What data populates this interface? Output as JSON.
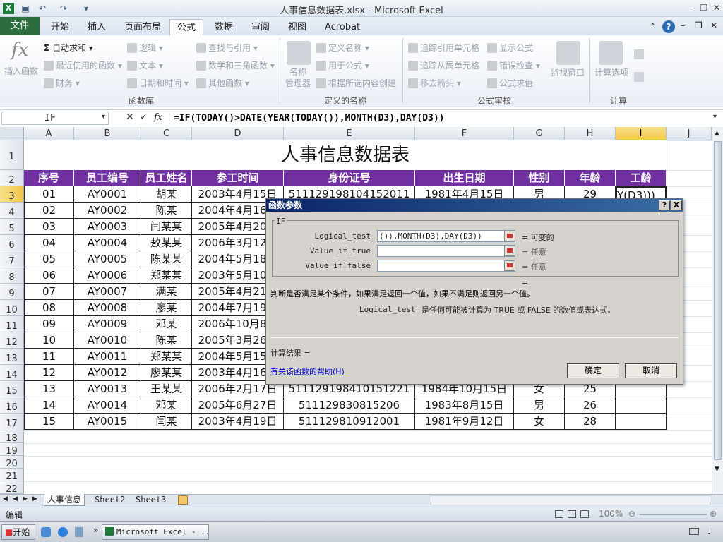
{
  "window": {
    "title": "人事信息数据表.xlsx  -  Microsoft Excel"
  },
  "tabs": {
    "file": "文件",
    "items": [
      "开始",
      "插入",
      "页面布局",
      "公式",
      "数据",
      "审阅",
      "视图",
      "Acrobat"
    ],
    "active": "公式"
  },
  "ribbon": {
    "insert_function": "插入函数",
    "autosum": "自动求和",
    "recent": "最近使用的函数",
    "financial": "财务",
    "logical": "逻辑",
    "text": "文本",
    "datetime": "日期和时间",
    "lookup": "查找与引用",
    "math": "数学和三角函数",
    "other": "其他函数",
    "group_library": "函数库",
    "name_manager": "名称\n管理器",
    "define_name": "定义名称",
    "use_in_formula": "用于公式",
    "create_from_sel": "根据所选内容创建",
    "group_names": "定义的名称",
    "trace_precedents": "追踪引用单元格",
    "trace_dependents": "追踪从属单元格",
    "remove_arrows": "移去箭头",
    "show_formulas": "显示公式",
    "error_check": "错误检查",
    "evaluate": "公式求值",
    "watch_window": "监视窗口",
    "group_audit": "公式审核",
    "calc_options": "计算选项",
    "group_calc": "计算"
  },
  "formula_bar": {
    "name_box": "IF",
    "fx": "fx",
    "formula": "=IF(TODAY()>DATE(YEAR(TODAY()),MONTH(D3),DAY(D3))"
  },
  "columns": [
    "A",
    "B",
    "C",
    "D",
    "E",
    "F",
    "G",
    "H",
    "I",
    "J"
  ],
  "rows": [
    "1",
    "2",
    "3",
    "4",
    "5",
    "6",
    "7",
    "8",
    "9",
    "10",
    "11",
    "12",
    "13",
    "14",
    "15",
    "16",
    "17",
    "18",
    "19",
    "20",
    "21",
    "22"
  ],
  "sheet": {
    "title": "人事信息数据表",
    "headers": [
      "序号",
      "员工编号",
      "员工姓名",
      "参工时间",
      "身份证号",
      "出生日期",
      "性别",
      "年龄",
      "工龄"
    ],
    "data": [
      [
        "01",
        "AY0001",
        "胡某",
        "2003年4月15日",
        "511129198104152011",
        "1981年4月15日",
        "男",
        "29",
        "Y(D3)))"
      ],
      [
        "02",
        "AY0002",
        "陈某",
        "2004年4月16日",
        "",
        "",
        "",
        "",
        ""
      ],
      [
        "03",
        "AY0003",
        "闫某某",
        "2005年4月20日",
        "",
        "",
        "",
        "",
        ""
      ],
      [
        "04",
        "AY0004",
        "敖某某",
        "2006年3月12日",
        "",
        "",
        "",
        "",
        ""
      ],
      [
        "05",
        "AY0005",
        "陈某某",
        "2004年5月18日",
        "",
        "",
        "",
        "",
        ""
      ],
      [
        "06",
        "AY0006",
        "郑某某",
        "2003年5月10日",
        "",
        "",
        "",
        "",
        ""
      ],
      [
        "07",
        "AY0007",
        "满某",
        "2005年4月21日",
        "",
        "",
        "",
        "",
        ""
      ],
      [
        "08",
        "AY0008",
        "廖某",
        "2004年7月19日",
        "",
        "",
        "",
        "",
        ""
      ],
      [
        "09",
        "AY0009",
        "邓某",
        "2006年10月8日",
        "",
        "",
        "",
        "",
        ""
      ],
      [
        "10",
        "AY0010",
        "陈某",
        "2005年3月26日",
        "",
        "",
        "",
        "",
        ""
      ],
      [
        "11",
        "AY0011",
        "郑某某",
        "2004年5月15日",
        "",
        "",
        "",
        "",
        ""
      ],
      [
        "12",
        "AY0012",
        "廖某某",
        "2003年4月16日",
        "",
        "",
        "",
        "",
        ""
      ],
      [
        "13",
        "AY0013",
        "王某某",
        "2006年2月17日",
        "511129198410151221",
        "1984年10月15日",
        "女",
        "25",
        ""
      ],
      [
        "14",
        "AY0014",
        "邓某",
        "2005年6月27日",
        "511129830815206",
        "1983年8月15日",
        "男",
        "26",
        ""
      ],
      [
        "15",
        "AY0015",
        "闫某",
        "2003年4月19日",
        "511129810912001",
        "1981年9月12日",
        "女",
        "28",
        ""
      ]
    ]
  },
  "dialog": {
    "title": "函数参数",
    "help_btn": "?",
    "close_btn": "X",
    "group": "IF",
    "args": [
      {
        "label": "Logical_test",
        "value": "()),MONTH(D3),DAY(D3))",
        "result": "= 可变的"
      },
      {
        "label": "Value_if_true",
        "value": "",
        "result": "= 任意"
      },
      {
        "label": "Value_if_false",
        "value": "",
        "result": "= 任意"
      }
    ],
    "eq": "=",
    "description": "判断是否满足某个条件，如果满足返回一个值，如果不满足则返回另一个值。",
    "arg_name": "Logical_test",
    "arg_desc": "是任何可能被计算为 TRUE 或 FALSE 的数值或表达式。",
    "calc_result": "计算结果 =",
    "help_link": "有关该函数的帮助(H)",
    "ok": "确定",
    "cancel": "取消"
  },
  "sheet_tabs": [
    "人事信息",
    "Sheet2",
    "Sheet3"
  ],
  "status": {
    "mode": "编辑",
    "zoom": "100%"
  },
  "taskbar": {
    "start": "开始",
    "task": "Microsoft Excel - ..."
  }
}
